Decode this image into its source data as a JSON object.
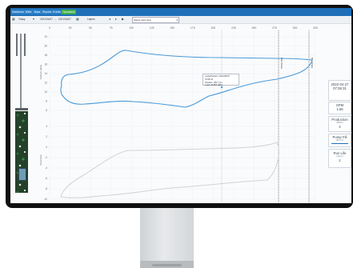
{
  "tabs": [
    {
      "label": "Dashboard"
    },
    {
      "label": "Wells"
    },
    {
      "label": "Maps"
    },
    {
      "label": "Reports"
    },
    {
      "label": "Events"
    },
    {
      "label": "Dynacards"
    }
  ],
  "toolbar": {
    "range_label": "Today",
    "start_date": "2021/04/07",
    "end_date": "2021/04/07",
    "layers_label": "Layers",
    "nav_icons": [
      "previous-icon",
      "next-icon",
      "play-icon"
    ],
    "card_type_placeholder": "Select card type",
    "calendar_icon": "calendar-icon"
  },
  "chart_data": {
    "type": "line",
    "x_ticks": [
      "0",
      "25",
      "50",
      "75",
      "100",
      "125",
      "150",
      "175",
      "200",
      "225",
      "250",
      "275",
      "300",
      "325"
    ],
    "upper_y_ticks": [
      "22",
      "20",
      "18",
      "16",
      "14",
      "12",
      "10",
      "8",
      "6"
    ],
    "lower_y_ticks": [
      "4",
      "2",
      "0",
      "-2",
      "-4",
      "-6",
      "-8",
      "-10"
    ],
    "upper_ylabel": "Surface (klbs)",
    "lower_ylabel": "Downhole",
    "marker_labels": [
      "Max Stroke",
      "Min Stroke"
    ],
    "series": [
      {
        "color": "#4a9ad8"
      },
      {
        "color": "#d0d4d8"
      }
    ]
  },
  "tooltip": {
    "line1": "Cycle/Position: 2021/04/07 07:06:31",
    "line2": "Position: 196.7 (in)",
    "line3": "Load: 15.857 (klbs)"
  },
  "metrics": [
    {
      "value": "2022-04-27",
      "sub": "07:06:31"
    },
    {
      "value": "SPM",
      "sub": "1.65"
    },
    {
      "value": "Production",
      "sub": "(BPD)",
      "extra": "3"
    },
    {
      "value": "Pump Fill",
      "sub": "48.0 %"
    },
    {
      "value": "Run Life",
      "sub": "(days)",
      "extra": "2"
    }
  ]
}
